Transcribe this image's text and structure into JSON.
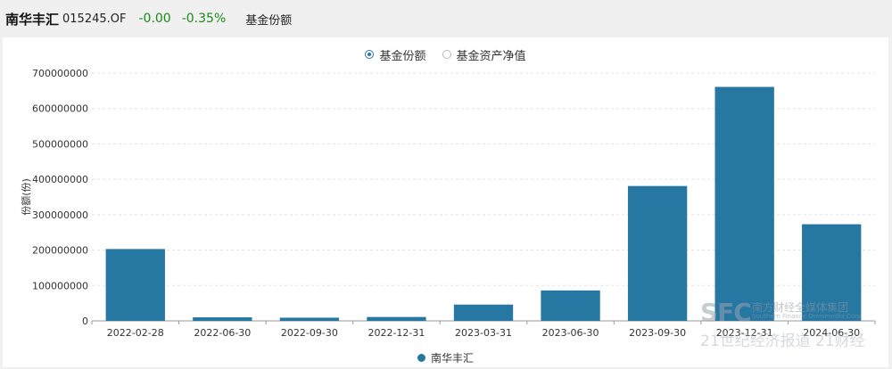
{
  "header": {
    "fund_name": "南华丰汇",
    "fund_code": "015245.OF",
    "change": "-0.00",
    "change_pct": "-0.35%",
    "tab_label": "基金份额"
  },
  "toggle": {
    "options": [
      {
        "label": "基金份额",
        "checked": true
      },
      {
        "label": "基金资产净值",
        "checked": false
      }
    ]
  },
  "colors": {
    "bar": "#2678a3",
    "positive_change": "#1a8a1a"
  },
  "chart_data": {
    "type": "bar",
    "ylabel": "份额(份)",
    "ylim": [
      0,
      700000000
    ],
    "yticks": [
      0,
      100000000,
      200000000,
      300000000,
      400000000,
      500000000,
      600000000,
      700000000
    ],
    "grid": true,
    "legend_position": "bottom-center",
    "categories": [
      "2022-02-28",
      "2022-06-30",
      "2022-09-30",
      "2022-12-31",
      "2023-03-31",
      "2023-06-30",
      "2023-09-30",
      "2023-12-31",
      "2024-06-30"
    ],
    "series": [
      {
        "name": "南华丰汇",
        "values": [
          203000000,
          10000000,
          9000000,
          11000000,
          46000000,
          86000000,
          381000000,
          661000000,
          273000000
        ]
      }
    ]
  },
  "watermark": {
    "logo": "SFC",
    "line1": "南方财经全媒体集团",
    "line2": "Southern Finance Omnimedia Corp",
    "line3": "21世纪经济报道 21财经"
  }
}
